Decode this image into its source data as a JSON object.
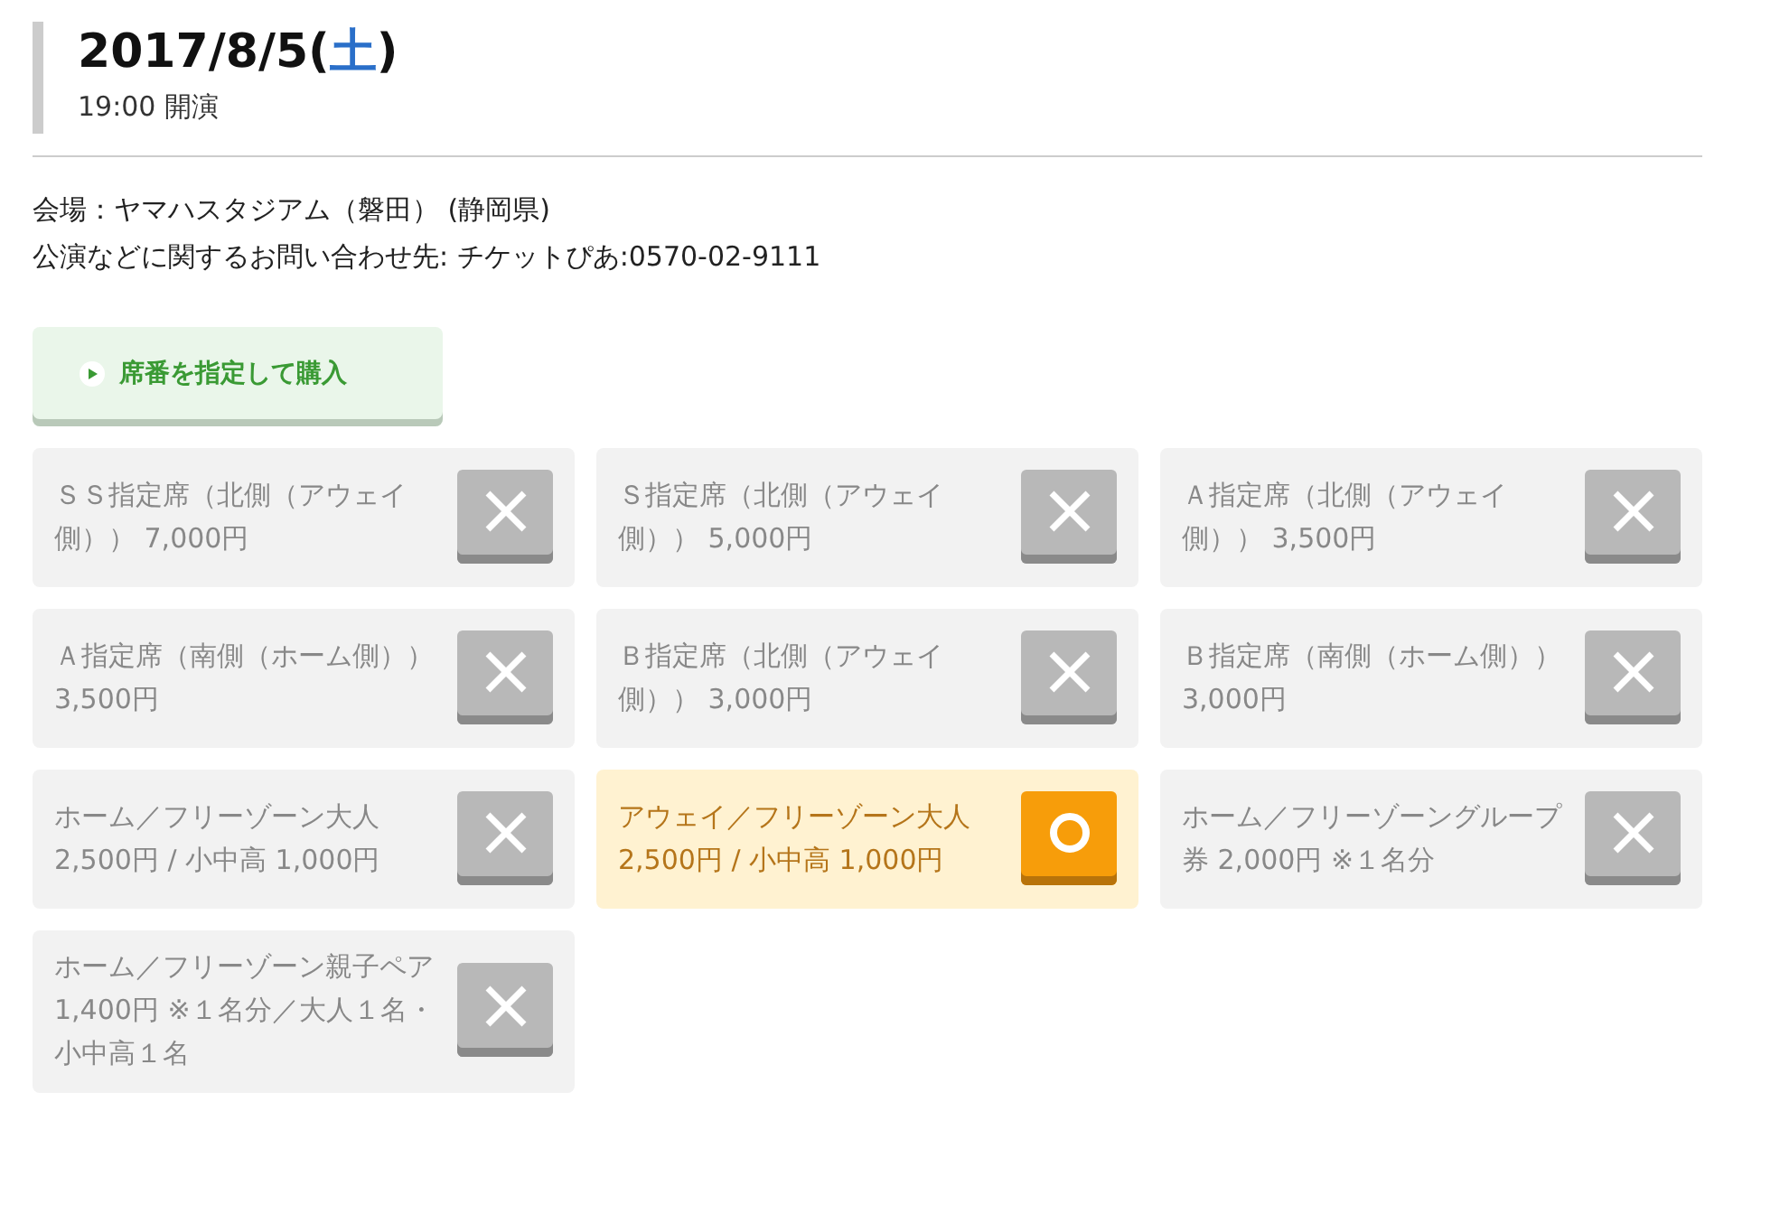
{
  "header": {
    "date": "2017/8/5(",
    "weekday": "土",
    "date_end": ")",
    "time": "19:00 開演"
  },
  "info": [
    "会場：ヤマハスタジアム（磐田） (静岡県)",
    "公演などに関するお問い合わせ先: チケットぴあ:0570-02-9111"
  ],
  "purchase_button": "席番を指定して購入",
  "seats": [
    {
      "label": "ＳＳ指定席（北側（アウェイ側）） 7,000円",
      "available": false
    },
    {
      "label": "Ｓ指定席（北側（アウェイ側）） 5,000円",
      "available": false
    },
    {
      "label": "Ａ指定席（北側（アウェイ側）） 3,500円",
      "available": false
    },
    {
      "label": "Ａ指定席（南側（ホーム側）） 3,500円",
      "available": false
    },
    {
      "label": "Ｂ指定席（北側（アウェイ側）） 3,000円",
      "available": false
    },
    {
      "label": "Ｂ指定席（南側（ホーム側）） 3,000円",
      "available": false
    },
    {
      "label": "ホーム／フリーゾーン大人 2,500円 / 小中高 1,000円",
      "available": false
    },
    {
      "label": "アウェイ／フリーゾーン大人 2,500円 / 小中高 1,000円",
      "available": true
    },
    {
      "label": "ホーム／フリーゾーングループ券 2,000円 ※１名分",
      "available": false
    },
    {
      "label": "ホーム／フリーゾーン親子ペア 1,400円 ※１名分／大人１名・小中高１名",
      "available": false
    }
  ]
}
